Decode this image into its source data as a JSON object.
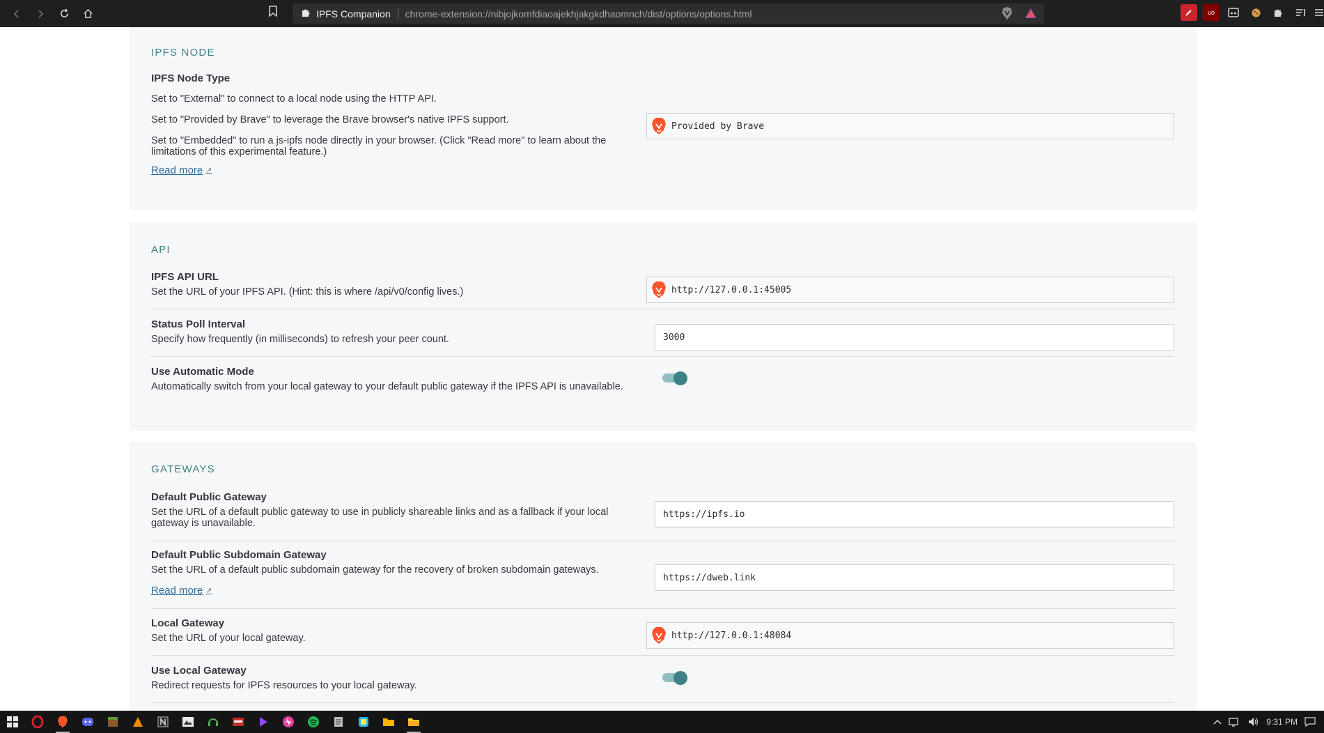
{
  "browser": {
    "nav": {
      "back_icon": "arrow-left-icon",
      "forward_icon": "arrow-right-icon",
      "reload_icon": "reload-icon",
      "home_icon": "home-icon"
    },
    "tab_title": "IPFS Companion",
    "url": "chrome-extension://nibjojkomfdiaoajekhjakgkdhaomnch/dist/options/options.html"
  },
  "sections": {
    "ipfs_node": {
      "title": "IPFS NODE",
      "node_type": {
        "label": "IPFS Node Type",
        "desc_external": "Set to \"External\" to connect to a local node using the HTTP API.",
        "desc_brave": "Set to \"Provided by Brave\" to leverage the Brave browser's native IPFS support.",
        "desc_embedded": "Set to \"Embedded\" to run a js-ipfs node directly in your browser. (Click \"Read more\" to learn about the limitations of this experimental feature.)",
        "read_more": "Read more",
        "value": "Provided by Brave"
      }
    },
    "api": {
      "title": "API",
      "api_url": {
        "label": "IPFS API URL",
        "desc": "Set the URL of your IPFS API. (Hint: this is where /api/v0/config lives.)",
        "value": "http://127.0.0.1:45005"
      },
      "poll_interval": {
        "label": "Status Poll Interval",
        "desc": "Specify how frequently (in milliseconds) to refresh your peer count.",
        "value": "3000"
      },
      "automatic_mode": {
        "label": "Use Automatic Mode",
        "desc": "Automatically switch from your local gateway to your default public gateway if the IPFS API is unavailable.",
        "enabled": true
      }
    },
    "gateways": {
      "title": "GATEWAYS",
      "public_gateway": {
        "label": "Default Public Gateway",
        "desc": "Set the URL of a default public gateway to use in publicly shareable links and as a fallback if your local gateway is unavailable.",
        "value": "https://ipfs.io"
      },
      "subdomain_gateway": {
        "label": "Default Public Subdomain Gateway",
        "desc": "Set the URL of a default public subdomain gateway for the recovery of broken subdomain gateways.",
        "read_more": "Read more",
        "value": "https://dweb.link"
      },
      "local_gateway": {
        "label": "Local Gateway",
        "desc": "Set the URL of your local gateway.",
        "value": "http://127.0.0.1:48084"
      },
      "use_local_gateway": {
        "label": "Use Local Gateway",
        "desc": "Redirect requests for IPFS resources to your local gateway.",
        "enabled": true
      }
    }
  },
  "taskbar": {
    "apps": [
      "start-icon",
      "opera-icon",
      "brave-icon",
      "discord-icon",
      "minecraft-icon",
      "vlc-icon",
      "notion-icon",
      "photo-app-icon",
      "headset-icon",
      "app-icon",
      "twitch-icon",
      "music-icon",
      "spotify-icon",
      "notes-icon",
      "app-icon",
      "folder-icon",
      "file-explorer-icon"
    ],
    "time": "9:31 PM"
  },
  "colors": {
    "accent": "#3e8287",
    "link": "#2e6c9c",
    "section_bg": "#f6f7f8"
  }
}
